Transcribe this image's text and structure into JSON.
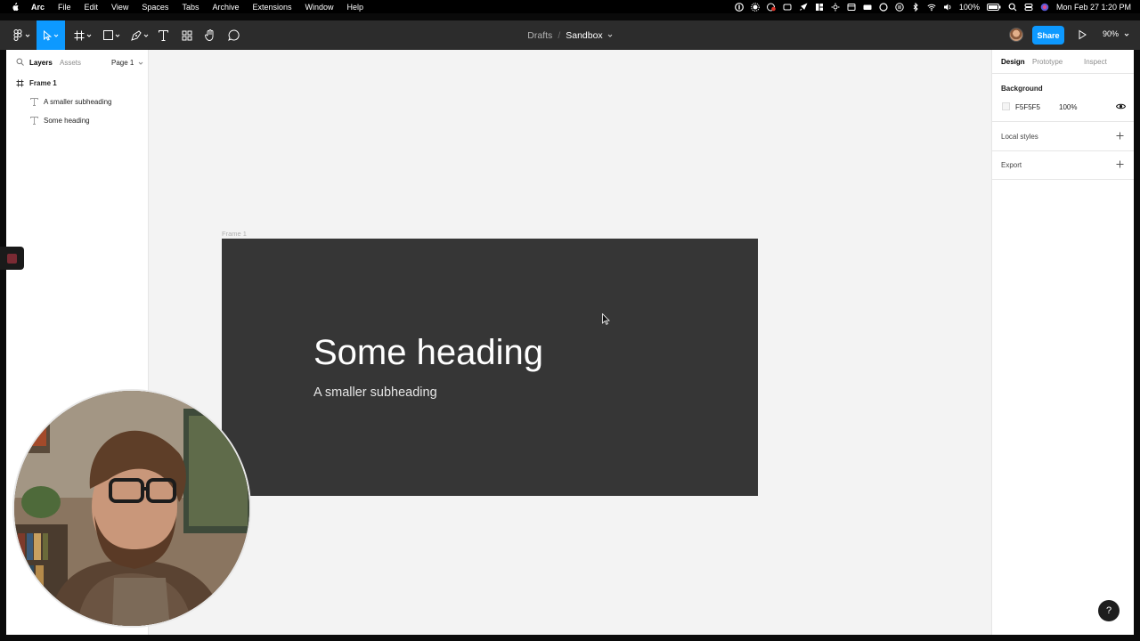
{
  "menubar": {
    "app": "Arc",
    "items": [
      "File",
      "Edit",
      "View",
      "Spaces",
      "Tabs",
      "Archive",
      "Extensions",
      "Window",
      "Help"
    ],
    "battery": "100%",
    "datetime": "Mon Feb 27  1:20 PM"
  },
  "toolbar": {
    "tools": [
      "main-menu-icon",
      "move-tool-icon",
      "frame-tool-icon",
      "shape-tool-icon",
      "pen-tool-icon",
      "text-tool-icon",
      "resources-icon",
      "hand-tool-icon",
      "comment-tool-icon"
    ],
    "breadcrumb_parent": "Drafts",
    "breadcrumb_sep": "/",
    "file_name": "Sandbox",
    "share_label": "Share",
    "zoom": "90%",
    "accent": "#0d99ff"
  },
  "left_panel": {
    "tabs": [
      "Layers",
      "Assets"
    ],
    "page": "Page 1",
    "layers": [
      {
        "name": "Frame 1",
        "type": "frame"
      },
      {
        "name": "A smaller subheading",
        "type": "text"
      },
      {
        "name": "Some heading",
        "type": "text"
      }
    ]
  },
  "canvas": {
    "frame_label": "Frame 1",
    "heading": "Some heading",
    "subheading": "A smaller subheading",
    "frame_color": "#363636",
    "canvas_color": "#f3f3f3"
  },
  "right_panel": {
    "tabs": [
      "Design",
      "Prototype",
      "Inspect"
    ],
    "background_label": "Background",
    "background_hex": "F5F5F5",
    "background_opacity": "100%",
    "local_styles_label": "Local styles",
    "export_label": "Export"
  },
  "help": "?"
}
